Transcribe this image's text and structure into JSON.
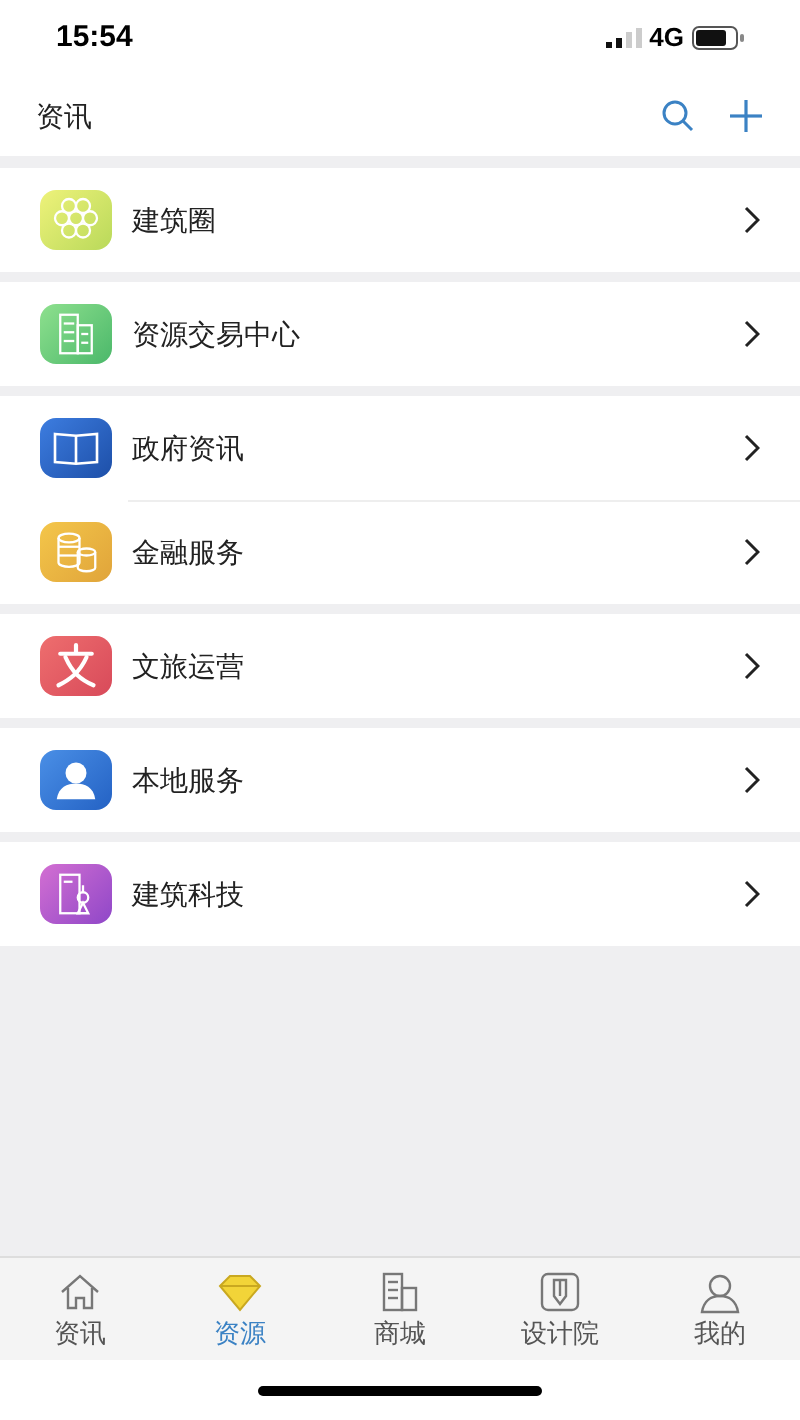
{
  "status_bar": {
    "time": "15:54",
    "network": "4G"
  },
  "header": {
    "title": "资讯"
  },
  "groups": [
    [
      {
        "label": "建筑圈"
      }
    ],
    [
      {
        "label": "资源交易中心"
      }
    ],
    [
      {
        "label": "政府资讯"
      },
      {
        "label": "金融服务"
      }
    ],
    [
      {
        "label": "文旅运营"
      }
    ],
    [
      {
        "label": "本地服务"
      }
    ],
    [
      {
        "label": "建筑科技"
      }
    ]
  ],
  "tabs": [
    {
      "label": "资讯",
      "selected": false
    },
    {
      "label": "资源",
      "selected": true
    },
    {
      "label": "商城",
      "selected": false
    },
    {
      "label": "设计院",
      "selected": false
    },
    {
      "label": "我的",
      "selected": false
    }
  ]
}
